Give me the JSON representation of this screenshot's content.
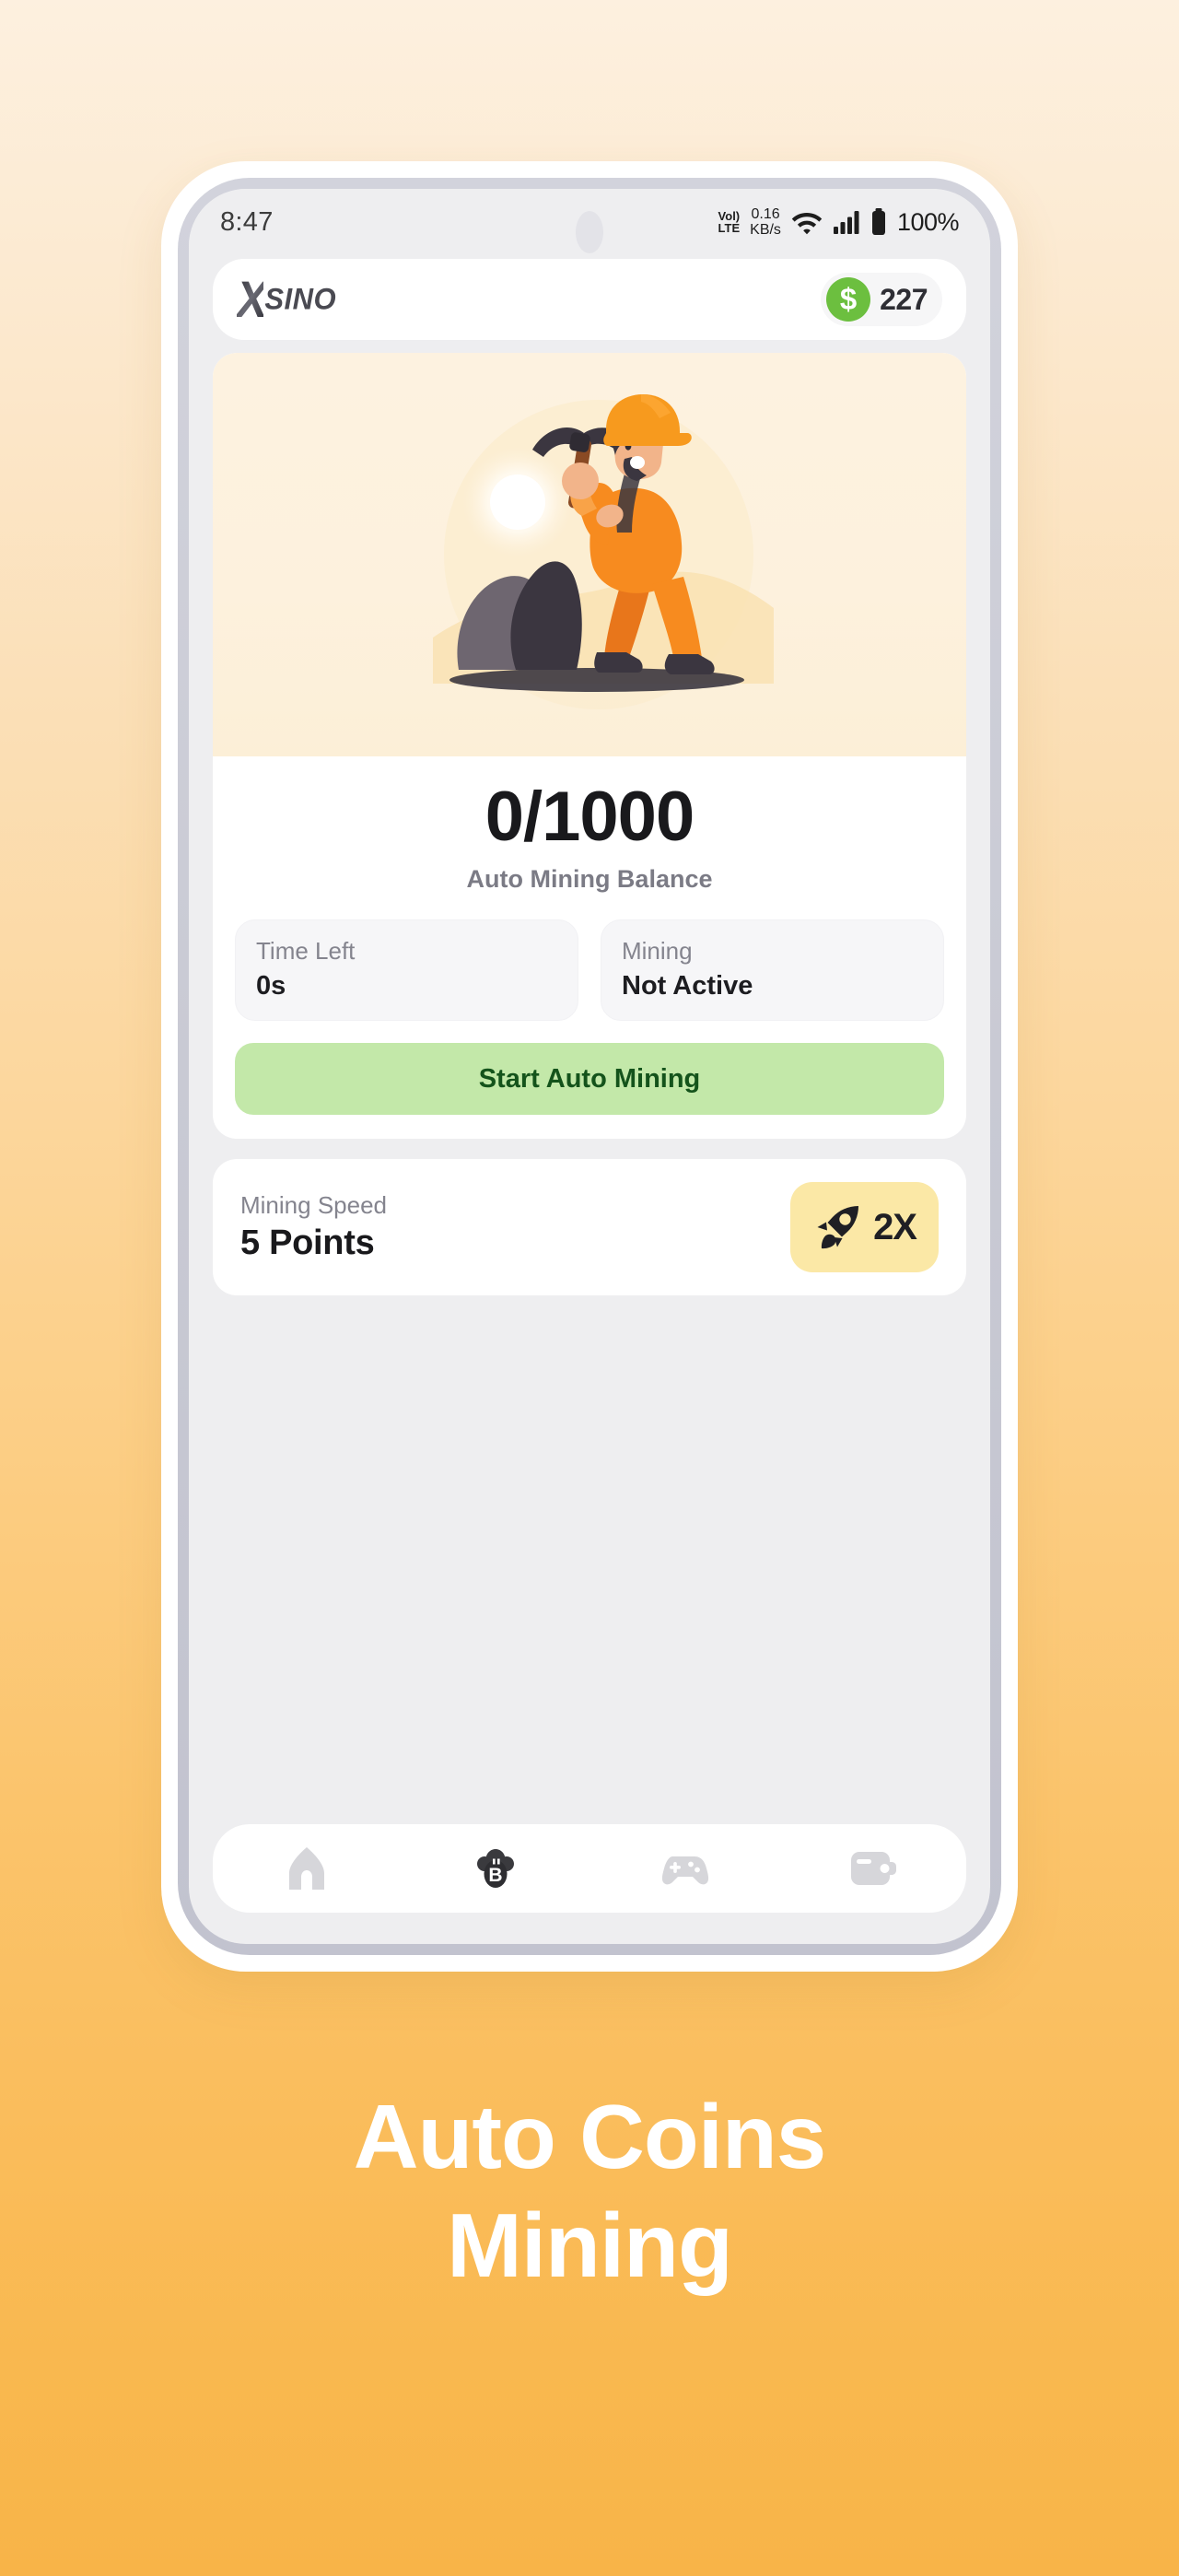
{
  "status_bar": {
    "time": "8:47",
    "volte_top": "Vol)",
    "volte_bottom": "LTE",
    "net_speed_value": "0.16",
    "net_speed_unit": "KB/s",
    "wifi_icon": "wifi-icon",
    "signal_icon": "cellular-signal-icon",
    "battery_icon": "battery-full-icon",
    "battery_percent": "100%"
  },
  "header": {
    "logo_x": "X",
    "logo_name": "SINO",
    "coin_symbol": "$",
    "coin_balance": "227"
  },
  "illustration": {
    "name": "miner-with-pickaxe-illustration",
    "colors": {
      "card_bg": "#fdf2e0",
      "suit": "#f78b1f",
      "suit_dark": "#e06f15",
      "helmet": "#f79a1e",
      "rock": "#3b3640",
      "rock_light": "#6e6670",
      "sun": "#fffdfa"
    }
  },
  "mining": {
    "balance": "0/1000",
    "balance_label": "Auto Mining Balance",
    "stats": [
      {
        "label": "Time Left",
        "value": "0s"
      },
      {
        "label": "Mining",
        "value": "Not Active"
      }
    ],
    "start_button": "Start Auto Mining"
  },
  "speed": {
    "label": "Mining Speed",
    "value": "5 Points",
    "boost_icon": "rocket-icon",
    "boost_multiplier": "2X"
  },
  "bottom_nav": {
    "items": [
      {
        "name": "home-icon",
        "active": false
      },
      {
        "name": "cloud-mining-bitcoin-icon",
        "active": true
      },
      {
        "name": "gamepad-icon",
        "active": false
      },
      {
        "name": "wallet-icon",
        "active": false
      }
    ]
  },
  "caption": {
    "line1": "Auto Coins",
    "line2": "Mining"
  },
  "theme": {
    "bg_top": "#fdf0df",
    "bg_bottom": "#f8b448",
    "accent_green": "#6cbf3f",
    "button_green_bg": "#c3e8a9",
    "button_green_text": "#14531b",
    "boost_yellow": "#fbe8a6",
    "app_bg": "#eeeef0"
  }
}
